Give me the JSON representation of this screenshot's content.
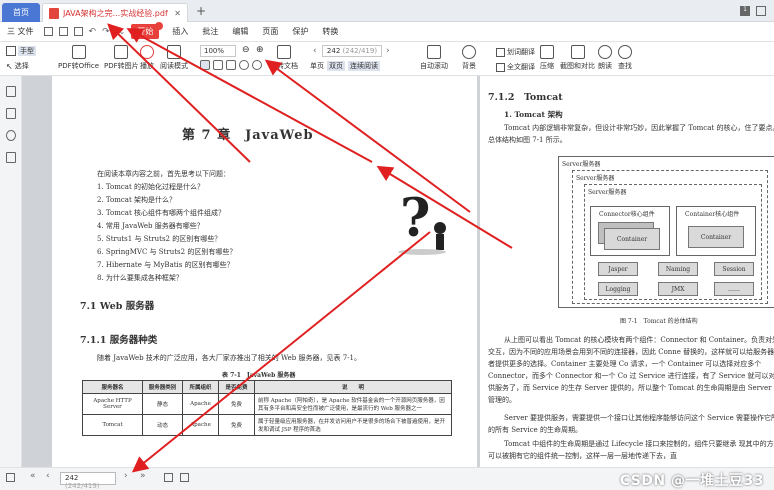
{
  "tabs": {
    "home": "首页",
    "doc": "JAVA架构之完...实战经验.pdf"
  },
  "menu": [
    "三 文件",
    "插入",
    "批注",
    "编辑",
    "页面",
    "保护",
    "转换"
  ],
  "menu_active": "开始",
  "ribbon": {
    "hand": "手型",
    "select": "选择",
    "pdf_to_office": "PDF转Office",
    "pdf_to_image": "PDF转图片",
    "play": "播放",
    "read_mode": "阅读模式",
    "zoom": "100%",
    "rotate": "旋转文档",
    "single": "单页",
    "double": "双页",
    "continuous": "连续阅读",
    "page_value": "242",
    "page_total": "(242/419)",
    "auto_scroll": "自动滚动",
    "background": "背景",
    "translate_word": "划词翻译",
    "translate_full": "全文翻译",
    "compress": "压缩",
    "screenshot_compare": "截图和对比",
    "read_aloud": "朗读",
    "find": "查找"
  },
  "left_page": {
    "chapter": "第 7 章　JavaWeb",
    "intro_lead": "在阅读本章内容之前，首先思考以下问题：",
    "questions": [
      "1. Tomcat 的初始化过程是什么？",
      "2. Tomcat 架构是什么？",
      "3. Tomcat 核心组件有哪两个组件组成？",
      "4. 常用 JavaWeb 服务器有哪些？",
      "5. Struts1 与 Struts2 的区别有哪些？",
      "6. SpringMVC 与 Struts2 的区别有哪些？",
      "7. Hibernate 与 MyBatis 的区别有哪些？",
      "8. 为什么要集成各种框架？"
    ],
    "section": "7.1  Web 服务器",
    "subsection": "7.1.1  服务器种类",
    "para": "随着 JavaWeb 技术的广泛应用，各大厂家亦推出了相关的 Web 服务器，见表 7-1。",
    "table_caption": "表 7-1　JavaWeb 服务器",
    "table_headers": [
      "服务器名",
      "服务器类别",
      "所属组织",
      "是否免费",
      "说　　明"
    ],
    "table_rows": [
      [
        "Apache HTTP Server",
        "静态",
        "Apache",
        "免费",
        "前称 Apache（阿帕奇），是 Apache 软件基金会的一个开源网页服务器，因其有多平台和高安全性而被广泛使用，是最流行的 Web 服务器之一"
      ],
      [
        "Tomcat",
        "动态",
        "Apache",
        "免费",
        "属于轻量级应用服务器，在并发访问用户不是很多的场合下被普遍使用，是开发和调试 JSP 程序的首选"
      ]
    ]
  },
  "right_page": {
    "heading": "7.1.2　Tomcat",
    "sub": "1. Tomcat 架构",
    "para1": "Tomcat 内部逻辑非常复杂，但设计非常巧妙，因此掌握了 Tomcat 的核心，住了要点。其总体结构如图 7-1 所示。",
    "diagram": {
      "server": "Server服务器",
      "service": "Server服务器",
      "service2": "Server服务器",
      "connector": "Connector核心组件",
      "container_comp": "Container核心组件",
      "container": "Container",
      "jasper": "Jasper",
      "naming": "Naming",
      "session": "Session",
      "logging": "Logging",
      "jmx": "JMX",
      "more": "……"
    },
    "figure_caption": "图 7-1　Tomcat 的总体结构",
    "para2": "从上图可以看出 Tomcat 的核心模块有两个组件：Connector 和 Container。负责对外数据交互，因为不同的应用场景会用到不同的连接器，因此 Conne 替换的，这样就可以给服务器设计者提供更多的选择。Container 主要处理 Co 请求，一个 Container 可以选择对应多个 Connector，而多个 Connector 和一个 Co 过 Service 进行连接，有了 Service 就可以对外提供服务了，而 Service 的生存 Server 提供的，所以整个 Tomcat 的生命周期是由 Server 进行管理的。",
    "para3": "Server 要提供服务，需要提供一个接口让其他程序能够访问这个 Service 需要操作它所包含的所有 Service 的生命周期。",
    "para4": "Tomcat 中组件的生命周期是通过 Lifecycle 接口来控制的，组件只要继承 现其中的方法就可以被拥有它的组件统一控制，这样一层一层地传递下去，直"
  },
  "bottom": {
    "page_value": "242",
    "page_total": "(242/419)"
  },
  "watermark": "CSDN @一堆土豆33"
}
